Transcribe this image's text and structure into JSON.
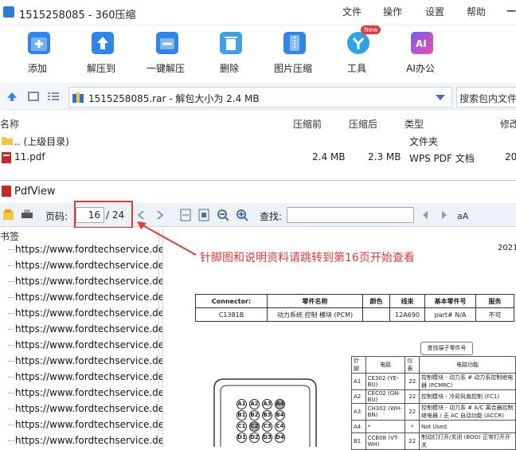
{
  "window": {
    "title": "1515258085 - 360压缩"
  },
  "menu": [
    "文件",
    "操作",
    "设置",
    "帮助"
  ],
  "toolbar": {
    "items": [
      {
        "label": "添加",
        "icon": "add-icon"
      },
      {
        "label": "解压到",
        "icon": "extract-to-icon"
      },
      {
        "label": "一键解压",
        "icon": "one-click-extract-icon"
      },
      {
        "label": "删除",
        "icon": "trash-icon"
      },
      {
        "label": "图片压缩",
        "icon": "image-compress-icon"
      },
      {
        "label": "工具",
        "icon": "tools-icon"
      },
      {
        "label": "AI办公",
        "icon": "ai-office-icon"
      }
    ],
    "new_badge": "New"
  },
  "address": {
    "path": "1515258085.rar - 解包大小为 2.4 MB",
    "search_placeholder": "搜索包内文件"
  },
  "filelist": {
    "headers": [
      "名称",
      "压缩前",
      "压缩后",
      "类型",
      "修改"
    ],
    "rows": [
      {
        "name": ".. (上级目录)",
        "before": "",
        "after": "",
        "type": "文件夹",
        "modified": ""
      },
      {
        "name": "11.pdf",
        "before": "2.4 MB",
        "after": "2.3 MB",
        "type": "WPS PDF 文档",
        "modified": "20"
      }
    ]
  },
  "pdfview": {
    "title": "PdfView",
    "page_label": "页码:",
    "page_current": "16",
    "page_total": "/ 24",
    "find_label": "查找:",
    "bookmarks_title": "书签",
    "bookmarks": [
      "https://www.fordtechservice.de",
      "https://www.fordtechservice.de",
      "https://www.fordtechservice.de",
      "https://www.fordtechservice.de",
      "https://www.fordtechservice.de",
      "https://www.fordtechservice.de",
      "https://www.fordtechservice.de",
      "https://www.fordtechservice.de",
      "https://www.fordtechservice.de",
      "https://www.fordtechservice.de",
      "https://www.fordtechservice.de",
      "https://www.fordtechservice.de",
      "https://www.fordtechservice.de"
    ]
  },
  "annotation": "针脚图和说明资料请跳转到第16页开始查看",
  "document": {
    "date_fragment": "2021/",
    "connector_table": {
      "headers": [
        "Connector:",
        "零件名称",
        "颜色",
        "线束",
        "基本零件号",
        "服务"
      ],
      "row": [
        "C1381B",
        "动力系统 控制 模块 (PCM)",
        "",
        "12A690",
        "part# N/A",
        "不可"
      ]
    },
    "find_part_button": "查找端子零件号",
    "pin_table": {
      "headers": [
        "针脚",
        "电路",
        "仪表",
        "电路功能"
      ],
      "rows": [
        [
          "A1",
          "CE302 (YE-BU)",
          "22",
          "控制模块 - 动力系 # 动力系控制继电器 (PCMRC)"
        ],
        [
          "A2",
          "CEC02 (GN-BU)",
          "22",
          "控制模块 - 冷却风扇控制 (FC1)"
        ],
        [
          "A3",
          "CH302 (WH-BN)",
          "22",
          "控制模块 - 动力系 # A/C 离合器控制继电器 / 无 AC 自动功能 (ACCR)"
        ],
        [
          "A4",
          "*",
          "*",
          "Not Used"
        ],
        [
          "B1",
          "CCB08 (VT-WH)",
          "22",
          "制动灯打开/关闭 (BOO) 正常打开开关"
        ]
      ]
    },
    "pins": [
      "A1",
      "A2",
      "A3",
      "A4",
      "B1",
      "B2",
      "B3",
      "B4",
      "C1",
      "C2",
      "C3",
      "C4",
      "D1",
      "D2",
      "D3",
      "D4"
    ]
  }
}
